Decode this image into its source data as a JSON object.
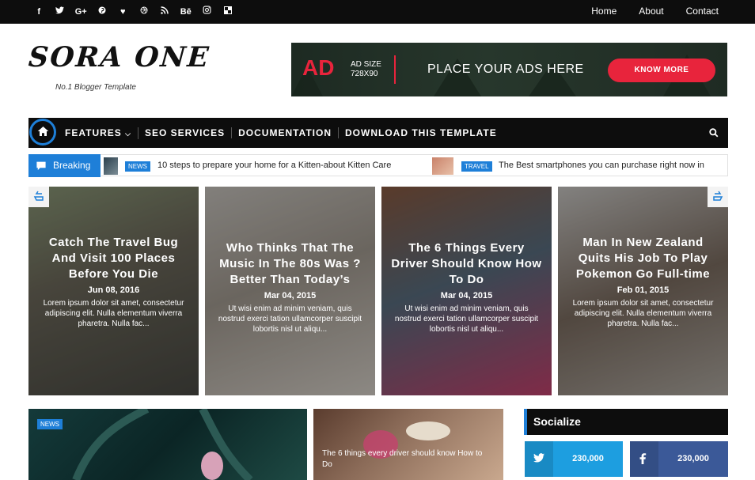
{
  "social_icons": [
    "facebook-icon",
    "twitter-icon",
    "google-plus-icon",
    "pinterest-icon",
    "heart-icon",
    "dribbble-icon",
    "rss-icon",
    "behance-icon",
    "instagram-icon",
    "delicious-icon"
  ],
  "top_links": [
    "Home",
    "About",
    "Contact"
  ],
  "site": {
    "logo": "SORA ONE",
    "tagline": "No.1 Blogger Template"
  },
  "ad": {
    "word": "AD",
    "size_line1": "AD SIZE",
    "size_line2": "728X90",
    "text": "PLACE YOUR ADS HERE",
    "button": "KNOW MORE"
  },
  "nav": {
    "features": "FEATURES",
    "seo": "SEO SERVICES",
    "docs": "DOCUMENTATION",
    "download": "DOWNLOAD THIS TEMPLATE"
  },
  "breaking": {
    "label": "Breaking",
    "items": [
      {
        "tag": "NEWS",
        "text": "10 steps to prepare your home for a Kitten-about Kitten Care"
      },
      {
        "tag": "TRAVEL",
        "text": "The Best smartphones you can purchase right now in"
      }
    ]
  },
  "slides": [
    {
      "title": "Catch The Travel Bug And Visit 100 Places Before You Die",
      "date": "Jun 08, 2016",
      "excerpt": "Lorem ipsum dolor sit amet, consectetur adipiscing elit. Nulla elementum viverra pharetra. Nulla fac..."
    },
    {
      "title": "Who Thinks That The Music In The 80s Was ?Better Than Today’s",
      "date": "Mar 04, 2015",
      "excerpt": "Ut wisi enim ad minim veniam, quis nostrud exerci tation ullamcorper suscipit lobortis nisl ut aliqu..."
    },
    {
      "title": "The 6 Things Every Driver Should Know How To Do",
      "date": "Mar 04, 2015",
      "excerpt": "Ut wisi enim ad minim veniam, quis nostrud exerci tation ullamcorper suscipit lobortis nisl ut aliqu..."
    },
    {
      "title": "Man In New Zealand Quits His Job To Play Pokemon Go Full-time",
      "date": "Feb 01, 2015",
      "excerpt": "Lorem ipsum dolor sit amet, consectetur adipiscing elit. Nulla elementum viverra pharetra. Nulla fac..."
    }
  ],
  "featured": {
    "tag": "NEWS",
    "second_title": "The 6 things every driver should know How to Do"
  },
  "socialize": {
    "title": "Socialize",
    "twitter_count": "230,000",
    "facebook_count": "230,000"
  },
  "colors": {
    "accent": "#1e7fd8",
    "ad_red": "#e8243c",
    "dark": "#0d0d0d"
  }
}
